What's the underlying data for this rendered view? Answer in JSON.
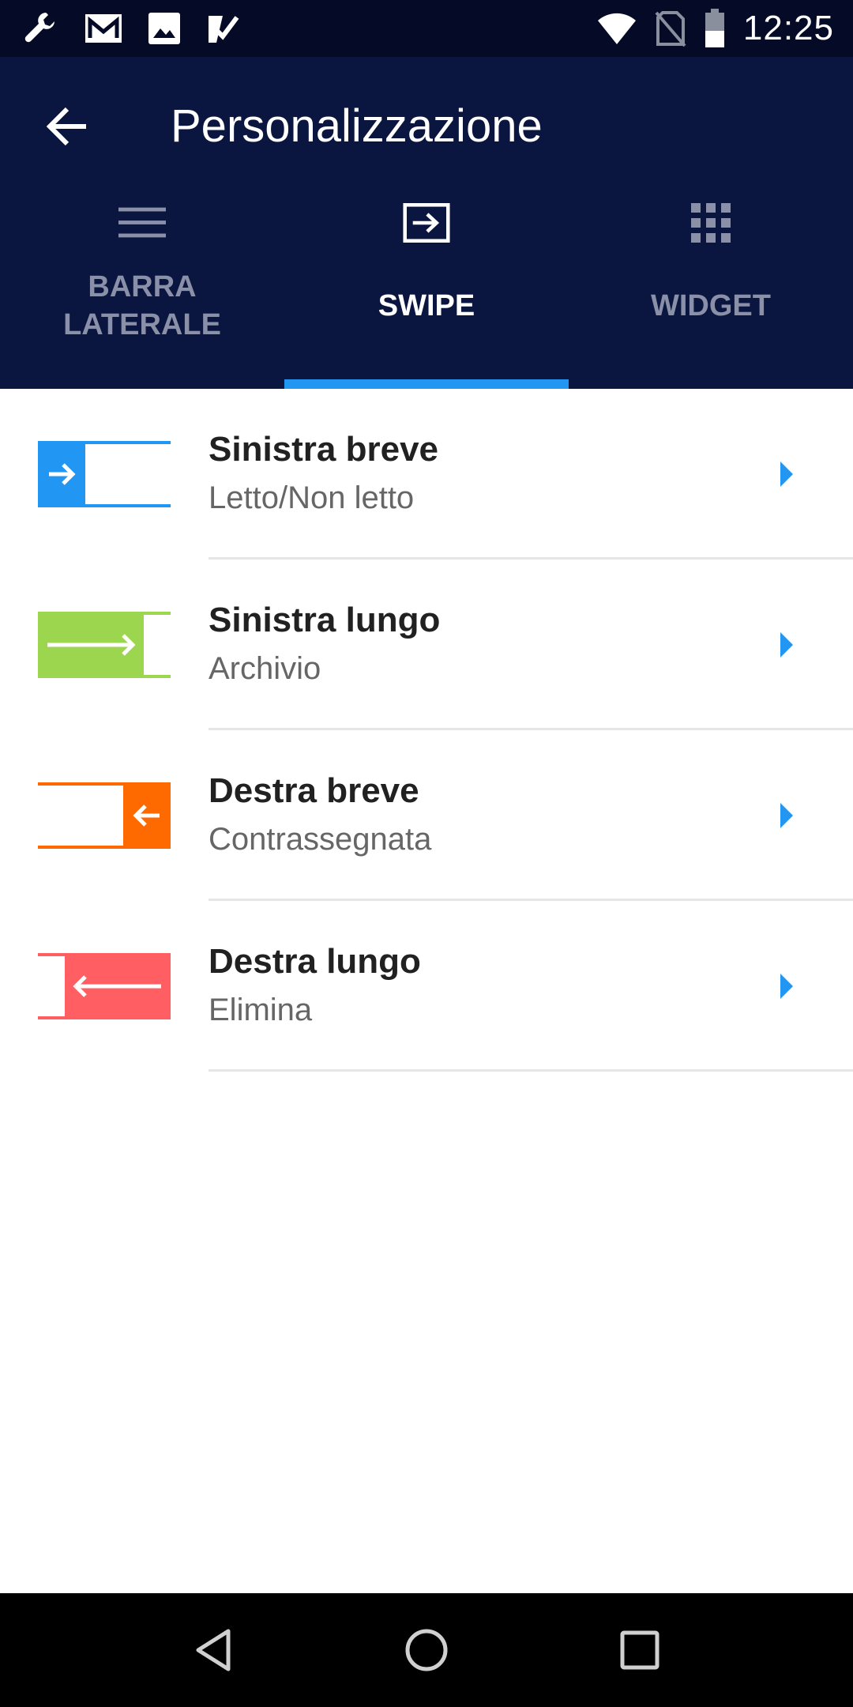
{
  "status_bar": {
    "time": "12:25",
    "left_icons": [
      "wrench-icon",
      "gmail-icon",
      "image-icon",
      "checkmark-icon"
    ],
    "right_icons": [
      "wifi-icon",
      "no-sim-icon",
      "battery-icon"
    ]
  },
  "header": {
    "title": "Personalizzazione",
    "back_icon": "arrow-back-icon",
    "background": "#0a1540"
  },
  "tabs": [
    {
      "label": "BARRA LATERALE",
      "icon": "menu-lines-icon",
      "active": false
    },
    {
      "label": "SWIPE",
      "icon": "swipe-arrow-box-icon",
      "active": true
    },
    {
      "label": "WIDGET",
      "icon": "grid-icon",
      "active": false
    }
  ],
  "accent_color": "#2196f3",
  "swipe_actions": [
    {
      "title": "Sinistra breve",
      "subtitle": "Letto/Non letto",
      "color": "#2196f3",
      "icon": "swipe-left-short-icon"
    },
    {
      "title": "Sinistra lungo",
      "subtitle": "Archivio",
      "color": "#9cd64e",
      "icon": "swipe-left-long-icon"
    },
    {
      "title": "Destra breve",
      "subtitle": "Contrassegnata",
      "color": "#ff6a00",
      "icon": "swipe-right-short-icon"
    },
    {
      "title": "Destra lungo",
      "subtitle": "Elimina",
      "color": "#ff5f62",
      "icon": "swipe-right-long-icon"
    }
  ],
  "nav_bar": {
    "buttons": [
      "back-triangle-icon",
      "home-circle-icon",
      "recents-square-icon"
    ]
  }
}
